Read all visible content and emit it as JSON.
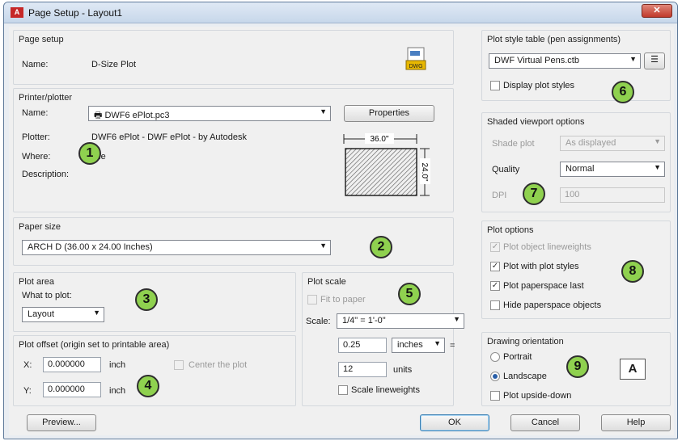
{
  "window": {
    "title": "Page Setup - Layout1",
    "app_logo": "A",
    "close_icon": "close-icon"
  },
  "page_setup": {
    "header": "Page setup",
    "name_label": "Name:",
    "name_value": "D-Size Plot",
    "file_icon_text": "DWG"
  },
  "printer": {
    "header": "Printer/plotter",
    "name_label": "Name:",
    "name_value": "DWF6 ePlot.pc3",
    "properties_button": "Properties",
    "plotter_label": "Plotter:",
    "plotter_value": "DWF6 ePlot - DWF ePlot - by Autodesk",
    "where_label": "Where:",
    "where_value": "File",
    "description_label": "Description:",
    "preview_width": "36.0\"",
    "preview_height": "24.0\""
  },
  "paper_size": {
    "header": "Paper size",
    "value": "ARCH D (36.00 x 24.00 Inches)"
  },
  "plot_area": {
    "header": "Plot area",
    "what_label": "What to plot:",
    "value": "Layout"
  },
  "plot_offset": {
    "header": "Plot offset (origin set to printable area)",
    "x_label": "X:",
    "x_value": "0.000000",
    "x_unit": "inch",
    "y_label": "Y:",
    "y_value": "0.000000",
    "y_unit": "inch",
    "center_label": "Center the plot"
  },
  "plot_scale": {
    "header": "Plot scale",
    "fit_label": "Fit to paper",
    "scale_label": "Scale:",
    "scale_value": "1/4\" = 1'-0\"",
    "inches_value": "0.25",
    "inches_unit": "inches",
    "equals": "=",
    "units_value": "12",
    "units_label": "units",
    "lineweights_label": "Scale lineweights"
  },
  "plot_style_table": {
    "header": "Plot style table (pen assignments)",
    "value": "DWF Virtual Pens.ctb",
    "display_label": "Display plot styles"
  },
  "shaded": {
    "header": "Shaded viewport options",
    "shade_label": "Shade plot",
    "shade_value": "As displayed",
    "quality_label": "Quality",
    "quality_value": "Normal",
    "dpi_label": "DPI",
    "dpi_value": "100"
  },
  "plot_options": {
    "header": "Plot options",
    "items": [
      {
        "label": "Plot object lineweights",
        "checked": true,
        "disabled": true
      },
      {
        "label": "Plot with plot styles",
        "checked": true,
        "disabled": false
      },
      {
        "label": "Plot paperspace last",
        "checked": true,
        "disabled": false
      },
      {
        "label": "Hide paperspace objects",
        "checked": false,
        "disabled": false
      }
    ]
  },
  "orientation": {
    "header": "Drawing orientation",
    "portrait": "Portrait",
    "landscape": "Landscape",
    "upside_down": "Plot upside-down",
    "selected": "Landscape",
    "orientation_icon_text": "A"
  },
  "footer": {
    "preview": "Preview...",
    "ok": "OK",
    "cancel": "Cancel",
    "help": "Help"
  },
  "badges": [
    "1",
    "2",
    "3",
    "4",
    "5",
    "6",
    "7",
    "8",
    "9"
  ],
  "colors": {
    "badge": "#8fd14f",
    "titlebar": "#c7d7ea",
    "close": "#c0392b"
  }
}
